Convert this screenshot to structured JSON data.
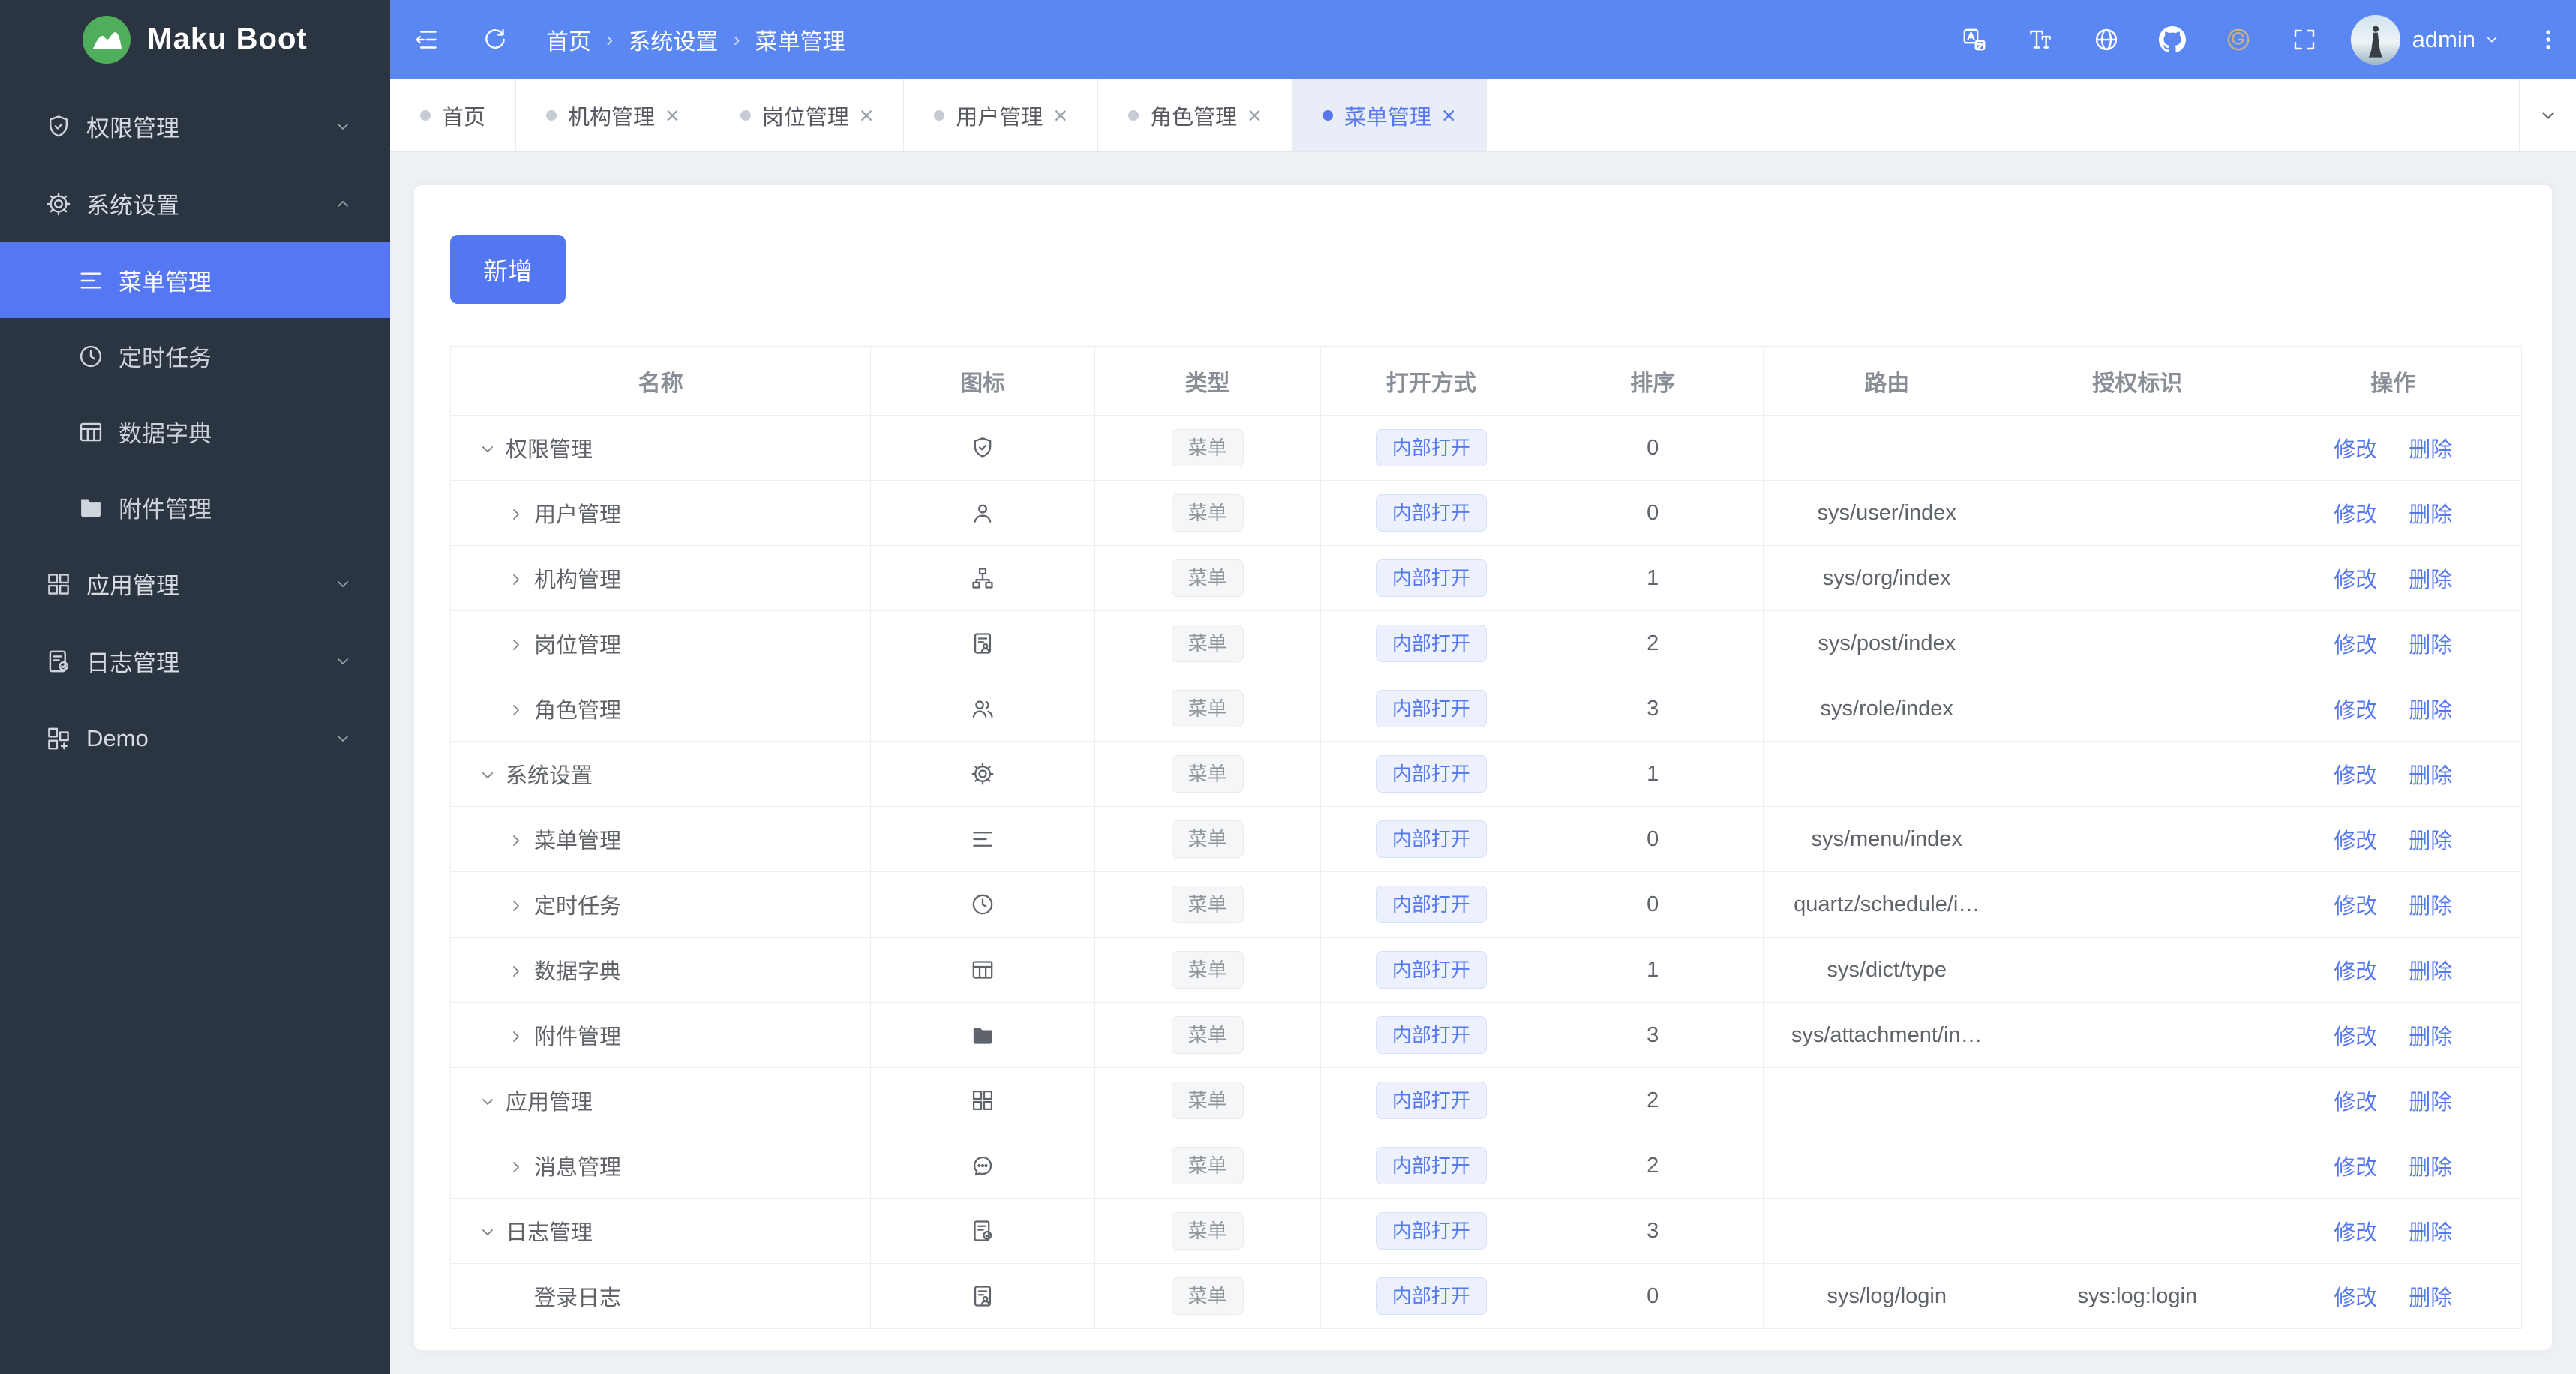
{
  "app": {
    "logo_text": "Maku Boot",
    "logo_icon": "logo"
  },
  "colors": {
    "topbar_blue": "#5b87f2",
    "primary_blue": "#5677f0",
    "sidebar_bg": "#2b3441",
    "logo_green": "#4fae5b",
    "content_bg": "#edf0f5",
    "tag_info_text": "#90949b",
    "tag_primary_text": "#5678ee"
  },
  "topbar": {
    "breadcrumb": [
      "首页",
      "系统设置",
      "菜单管理"
    ],
    "right_icons": [
      "translate",
      "font-size",
      "globe",
      "github",
      "gitee",
      "fullscreen"
    ],
    "user": {
      "name": "admin",
      "avatar_icon": "avatar"
    }
  },
  "tabs": [
    {
      "id": "home",
      "label": "首页",
      "closable": false,
      "active": false
    },
    {
      "id": "org",
      "label": "机构管理",
      "closable": true,
      "active": false
    },
    {
      "id": "post",
      "label": "岗位管理",
      "closable": true,
      "active": false
    },
    {
      "id": "user",
      "label": "用户管理",
      "closable": true,
      "active": false
    },
    {
      "id": "role",
      "label": "角色管理",
      "closable": true,
      "active": false
    },
    {
      "id": "menu",
      "label": "菜单管理",
      "closable": true,
      "active": true
    }
  ],
  "sidebar": {
    "items": [
      {
        "id": "permission",
        "label": "权限管理",
        "icon": "shield-check",
        "expanded": false
      },
      {
        "id": "system",
        "label": "系统设置",
        "icon": "gear",
        "expanded": true,
        "children": [
          {
            "id": "menu-mgmt",
            "label": "菜单管理",
            "icon": "menu",
            "active": true
          },
          {
            "id": "schedule",
            "label": "定时任务",
            "icon": "clock",
            "active": false
          },
          {
            "id": "dict",
            "label": "数据字典",
            "icon": "table",
            "active": false
          },
          {
            "id": "attachment",
            "label": "附件管理",
            "icon": "folder",
            "active": false
          }
        ]
      },
      {
        "id": "apps",
        "label": "应用管理",
        "icon": "apps",
        "expanded": false
      },
      {
        "id": "logs",
        "label": "日志管理",
        "icon": "doc-check",
        "expanded": false
      },
      {
        "id": "demo",
        "label": "Demo",
        "icon": "apps2",
        "expanded": false
      }
    ]
  },
  "content": {
    "add_button": "新增",
    "table": {
      "headers": [
        "名称",
        "图标",
        "类型",
        "打开方式",
        "排序",
        "路由",
        "授权标识",
        "操作"
      ],
      "actions": [
        "修改",
        "删除"
      ],
      "rows": [
        {
          "name": "权限管理",
          "level": 0,
          "arrow": "down",
          "icon": "shield-check",
          "type": "菜单",
          "open_mode": "内部打开",
          "sort": "0",
          "route": "",
          "auth": ""
        },
        {
          "name": "用户管理",
          "level": 1,
          "arrow": "right",
          "icon": "user",
          "type": "菜单",
          "open_mode": "内部打开",
          "sort": "0",
          "route": "sys/user/index",
          "auth": ""
        },
        {
          "name": "机构管理",
          "level": 1,
          "arrow": "right",
          "icon": "org",
          "type": "菜单",
          "open_mode": "内部打开",
          "sort": "1",
          "route": "sys/org/index",
          "auth": ""
        },
        {
          "name": "岗位管理",
          "level": 1,
          "arrow": "right",
          "icon": "doc-user",
          "type": "菜单",
          "open_mode": "内部打开",
          "sort": "2",
          "route": "sys/post/index",
          "auth": ""
        },
        {
          "name": "角色管理",
          "level": 1,
          "arrow": "right",
          "icon": "users",
          "type": "菜单",
          "open_mode": "内部打开",
          "sort": "3",
          "route": "sys/role/index",
          "auth": ""
        },
        {
          "name": "系统设置",
          "level": 0,
          "arrow": "down",
          "icon": "gear",
          "type": "菜单",
          "open_mode": "内部打开",
          "sort": "1",
          "route": "",
          "auth": ""
        },
        {
          "name": "菜单管理",
          "level": 1,
          "arrow": "right",
          "icon": "menu",
          "type": "菜单",
          "open_mode": "内部打开",
          "sort": "0",
          "route": "sys/menu/index",
          "auth": ""
        },
        {
          "name": "定时任务",
          "level": 1,
          "arrow": "right",
          "icon": "clock",
          "type": "菜单",
          "open_mode": "内部打开",
          "sort": "0",
          "route": "quartz/schedule/i…",
          "auth": ""
        },
        {
          "name": "数据字典",
          "level": 1,
          "arrow": "right",
          "icon": "table",
          "type": "菜单",
          "open_mode": "内部打开",
          "sort": "1",
          "route": "sys/dict/type",
          "auth": ""
        },
        {
          "name": "附件管理",
          "level": 1,
          "arrow": "right",
          "icon": "folder",
          "type": "菜单",
          "open_mode": "内部打开",
          "sort": "3",
          "route": "sys/attachment/in…",
          "auth": ""
        },
        {
          "name": "应用管理",
          "level": 0,
          "arrow": "down",
          "icon": "apps",
          "type": "菜单",
          "open_mode": "内部打开",
          "sort": "2",
          "route": "",
          "auth": ""
        },
        {
          "name": "消息管理",
          "level": 1,
          "arrow": "right",
          "icon": "chat",
          "type": "菜单",
          "open_mode": "内部打开",
          "sort": "2",
          "route": "",
          "auth": ""
        },
        {
          "name": "日志管理",
          "level": 0,
          "arrow": "down",
          "icon": "doc-check",
          "type": "菜单",
          "open_mode": "内部打开",
          "sort": "3",
          "route": "",
          "auth": ""
        },
        {
          "name": "登录日志",
          "level": 1,
          "arrow": null,
          "icon": "doc-user",
          "type": "菜单",
          "open_mode": "内部打开",
          "sort": "0",
          "route": "sys/log/login",
          "auth": "sys:log:login"
        }
      ]
    }
  }
}
